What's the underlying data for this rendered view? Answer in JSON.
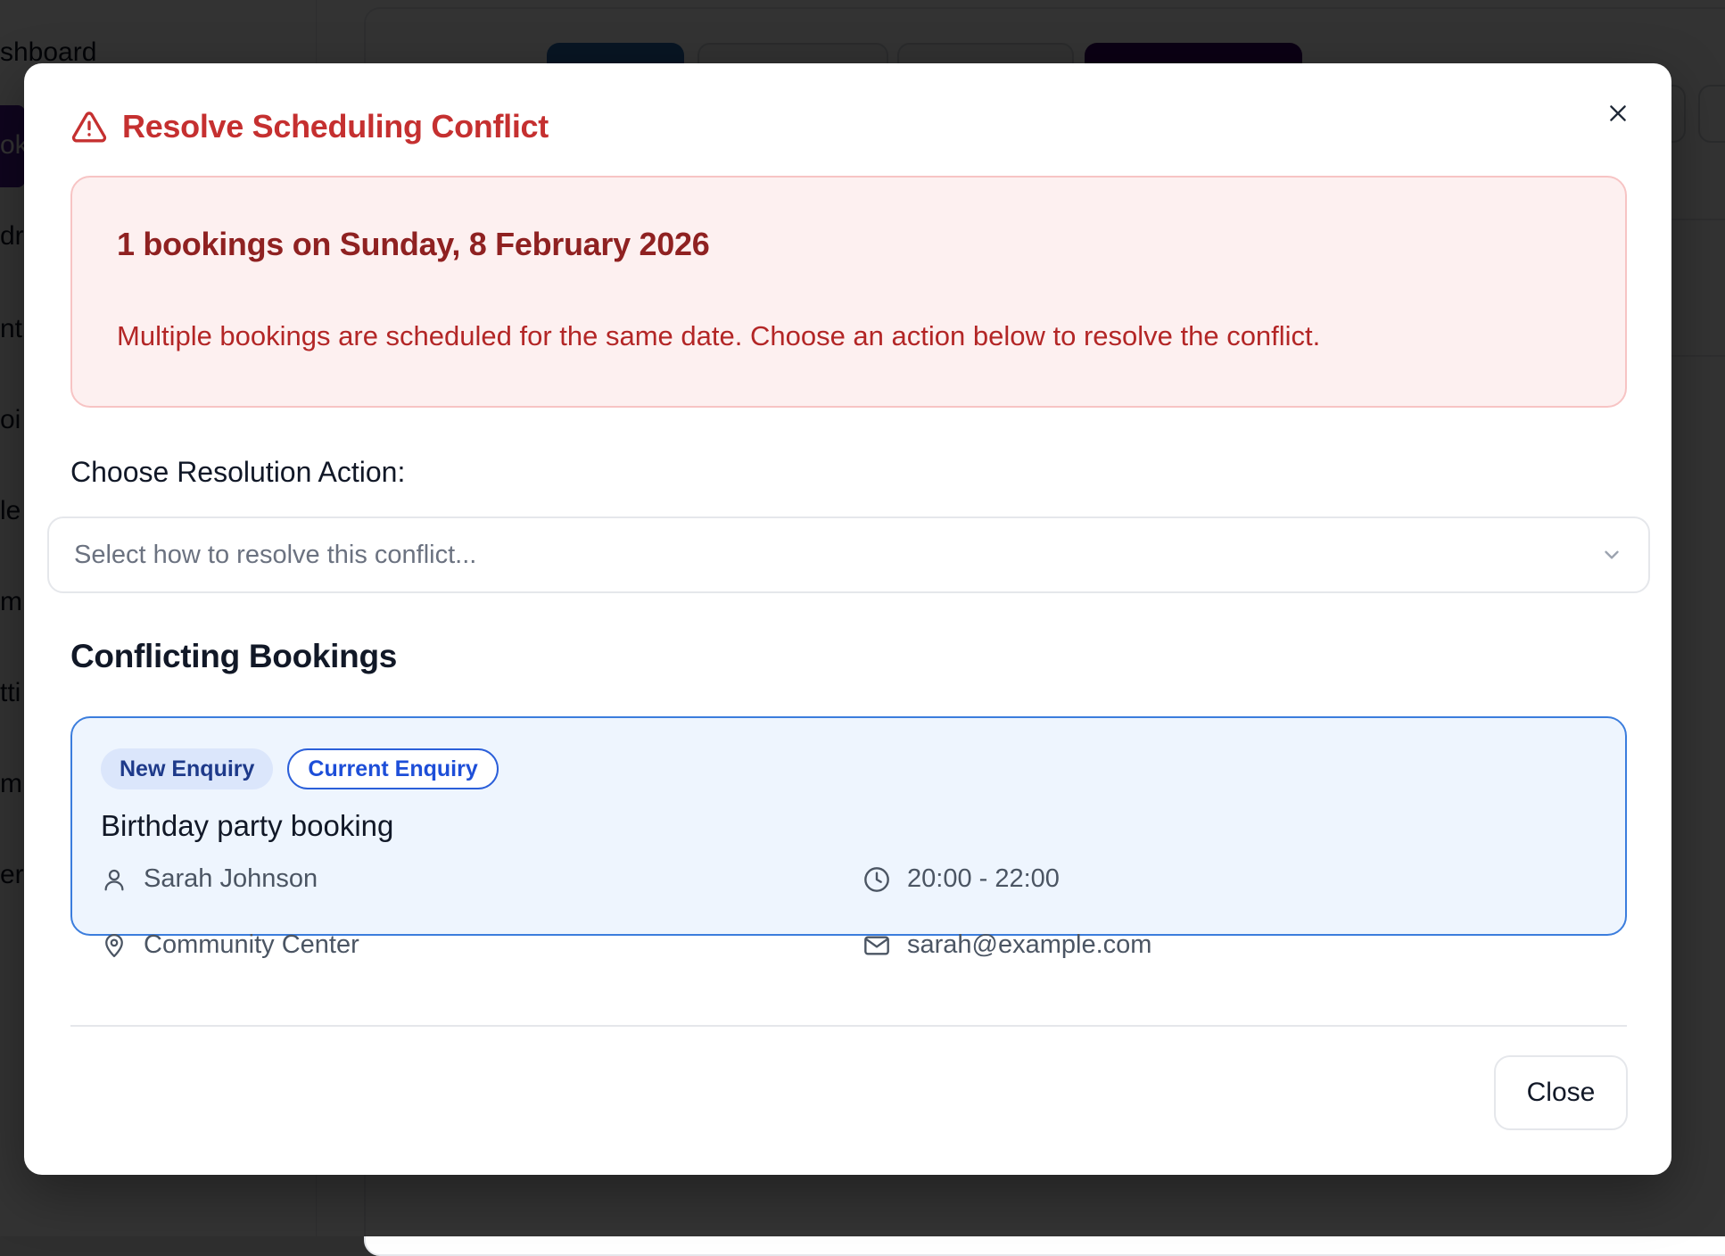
{
  "background": {
    "sidebar_items": [
      "shboard",
      "ok",
      "dr",
      "nt",
      "oi",
      "le",
      "m",
      "tti",
      "mp",
      "er"
    ],
    "accent": "#4c1d95"
  },
  "modal": {
    "title": "Resolve Scheduling Conflict",
    "title_icon": "warning-triangle-icon",
    "close_icon": "close-icon",
    "alert": {
      "heading": "1 bookings on Sunday, 8 February 2026",
      "text": "Multiple bookings are scheduled for the same date. Choose an action below to resolve the conflict."
    },
    "resolution": {
      "label": "Choose Resolution Action:",
      "placeholder": "Select how to resolve this conflict...",
      "icon": "chevron-down-icon"
    },
    "conflicting_title": "Conflicting Bookings",
    "bookings": [
      {
        "badges": [
          "New Enquiry",
          "Current Enquiry"
        ],
        "title": "Birthday party booking",
        "contact_name": "Sarah Johnson",
        "time": "20:00 - 22:00",
        "location": "Community Center",
        "email": "sarah@example.com"
      }
    ],
    "close_button": "Close"
  },
  "colors": {
    "danger": "#c53030",
    "alert_bg": "#fdf0f0",
    "card_border": "#3b7ddd",
    "card_bg": "#eef5fe"
  }
}
